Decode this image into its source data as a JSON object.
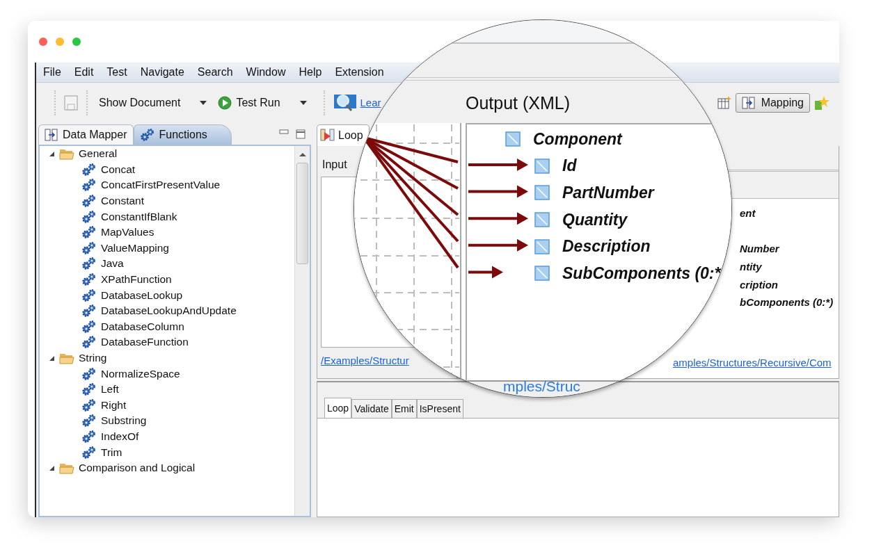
{
  "menu": [
    "File",
    "Edit",
    "Test",
    "Navigate",
    "Search",
    "Window",
    "Help",
    "Extension"
  ],
  "toolbar": {
    "save": {
      "disabled": true
    },
    "show_document": "Show Document",
    "test_run": "Test Run",
    "learn_link": "Lear",
    "mapping": {
      "label": "Mapping",
      "selected": true
    }
  },
  "left_tabs": [
    {
      "label": "Data Mapper",
      "selected": false
    },
    {
      "label": "Functions",
      "selected": true
    }
  ],
  "function_tree": [
    {
      "label": "General",
      "expanded": true,
      "children": [
        {
          "label": "Concat"
        },
        {
          "label": "ConcatFirstPresentValue"
        },
        {
          "label": "Constant"
        },
        {
          "label": "ConstantIfBlank"
        },
        {
          "label": "MapValues"
        },
        {
          "label": "ValueMapping"
        },
        {
          "label": "Java"
        },
        {
          "label": "XPathFunction"
        },
        {
          "label": "DatabaseLookup"
        },
        {
          "label": "DatabaseLookupAndUpdate"
        },
        {
          "label": "DatabaseColumn"
        },
        {
          "label": "DatabaseFunction"
        }
      ]
    },
    {
      "label": "String",
      "expanded": true,
      "children": [
        {
          "label": "NormalizeSpace"
        },
        {
          "label": "Left"
        },
        {
          "label": "Right"
        },
        {
          "label": "Substring"
        },
        {
          "label": "IndexOf"
        },
        {
          "label": "Trim"
        }
      ]
    },
    {
      "label": "Comparison and Logical",
      "expanded": true
    }
  ],
  "editor_tab": {
    "label": "Loop",
    "selected": true
  },
  "input_panel": {
    "label": "Input",
    "link": "/Examples/Structur"
  },
  "output_fragments": [
    "ent",
    "Number",
    "ntity",
    "cription",
    "bComponents (0:*)"
  ],
  "output_link": "amples/Structures/Recursive/Com",
  "bottom_tabs": [
    {
      "label": "Loop",
      "selected": true
    },
    {
      "label": "Validate",
      "selected": false
    },
    {
      "label": "Emit",
      "selected": false
    },
    {
      "label": "IsPresent",
      "selected": false
    }
  ],
  "magnifier": {
    "title": "Output (XML)",
    "root": "Component",
    "fields": [
      {
        "label": "Id",
        "kind": "full"
      },
      {
        "label": "PartNumber",
        "kind": "full"
      },
      {
        "label": "Quantity",
        "kind": "full"
      },
      {
        "label": "Description",
        "kind": "full"
      },
      {
        "label": "SubComponents (0:*",
        "kind": "short"
      }
    ],
    "link_text": "mples/Struc"
  }
}
